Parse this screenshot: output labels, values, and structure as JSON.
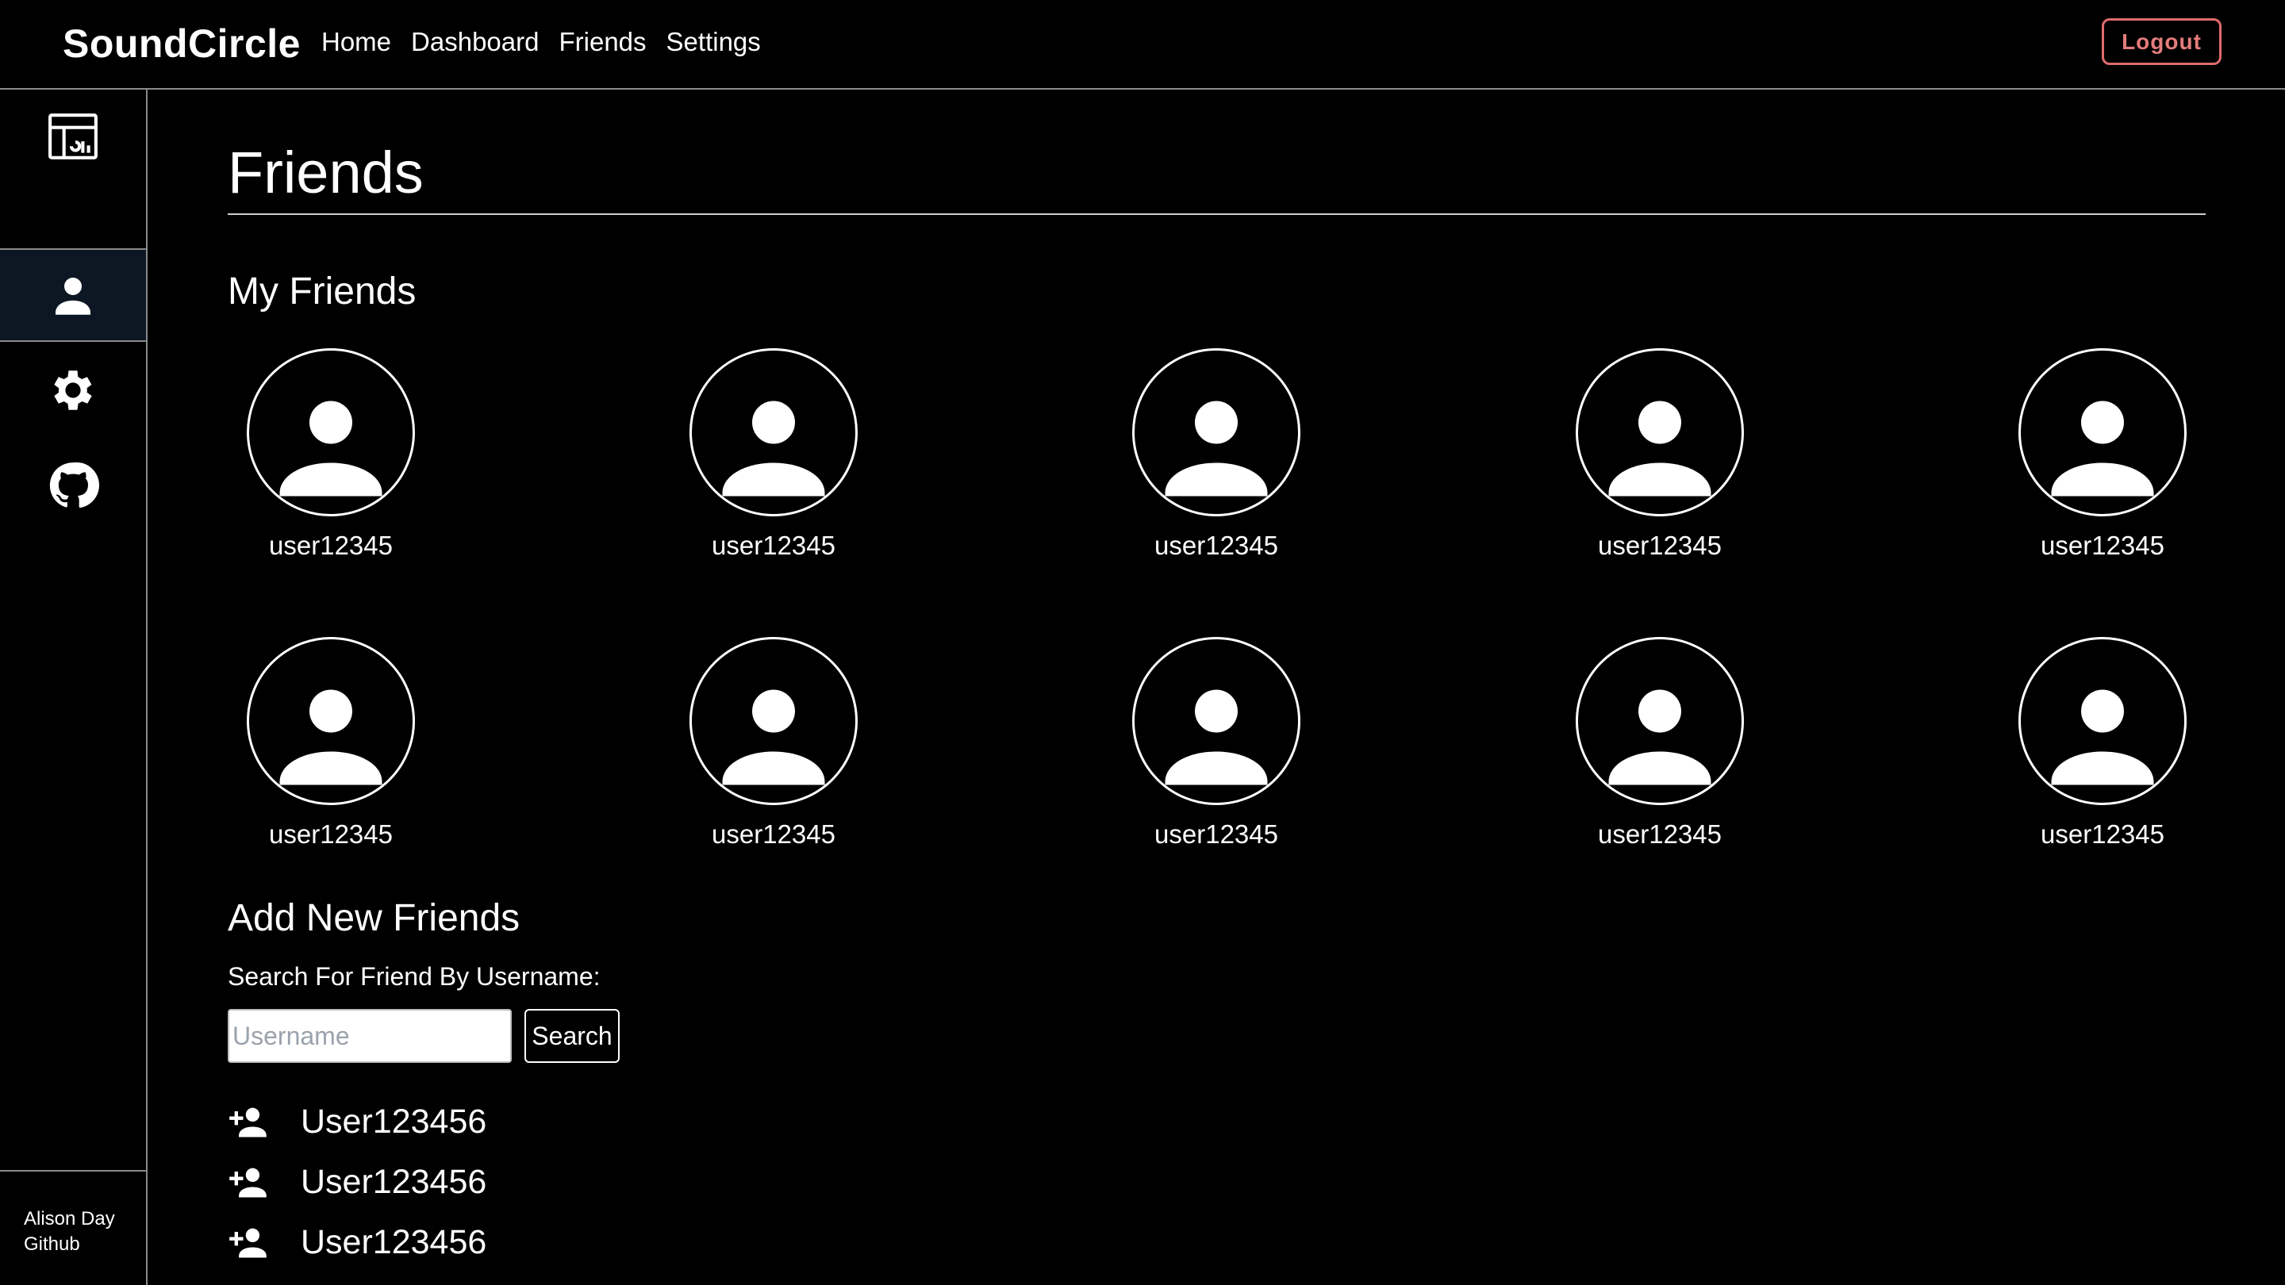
{
  "navbar": {
    "brand": "SoundCircle",
    "links": [
      "Home",
      "Dashboard",
      "Friends",
      "Settings"
    ],
    "logout_label": "Logout",
    "logout_color": "#e06c6c"
  },
  "sidebar": {
    "items": [
      {
        "icon": "dashboard-icon",
        "active": false
      },
      {
        "icon": "person-icon",
        "active": true
      },
      {
        "icon": "gear-icon",
        "active": false
      },
      {
        "icon": "github-icon",
        "active": false
      }
    ],
    "footer_name": "Alison Day",
    "footer_link": "Github",
    "active_color": "#0d1724"
  },
  "main": {
    "title": "Friends",
    "my_friends_title": "My Friends",
    "friends": [
      "user12345",
      "user12345",
      "user12345",
      "user12345",
      "user12345",
      "user12345",
      "user12345",
      "user12345",
      "user12345",
      "user12345"
    ],
    "add_section_title": "Add New Friends",
    "search_label": "Search For Friend By Username:",
    "search_placeholder": "Username",
    "search_button": "Search",
    "results": [
      "User123456",
      "User123456",
      "User123456"
    ]
  }
}
